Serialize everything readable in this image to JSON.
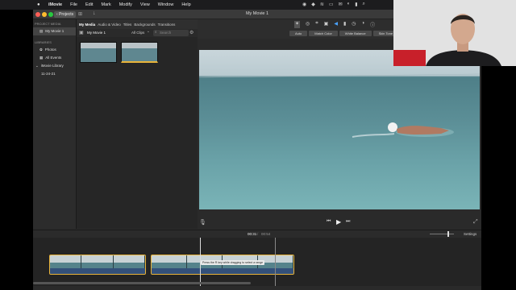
{
  "menubar": {
    "app": "iMovie",
    "items": [
      "File",
      "Edit",
      "Mark",
      "Modify",
      "View",
      "Window",
      "Help"
    ]
  },
  "window": {
    "title": "My Movie 1",
    "projects_button": "‹ Projects"
  },
  "sidebar": {
    "project_media_heading": "PROJECT MEDIA",
    "project_item": "My Movie 1",
    "libraries_heading": "LIBRARIES",
    "library_items": [
      "Photos",
      "All Events",
      "iMovie Library",
      "11-24-21"
    ]
  },
  "browser": {
    "tabs": [
      "My Media",
      "Audio & Video",
      "Titles",
      "Backgrounds",
      "Transitions"
    ],
    "project_label": "My Movie 1",
    "filter": "All Clips",
    "search_placeholder": "Search"
  },
  "viewer": {
    "adjust_buttons": [
      "Auto",
      "Match Color",
      "White Balance",
      "Skin Tone Balance"
    ]
  },
  "timeline": {
    "timecode_current": "00:31",
    "timecode_separator": "/",
    "timecode_total": "00:54",
    "settings_label": "Settings",
    "tooltip": "Press the R key while dragging to select a range"
  },
  "colors": {
    "accent_clip_border": "#e9b43a",
    "audio_track": "#33507a",
    "selected_tab": "#ffffff"
  }
}
